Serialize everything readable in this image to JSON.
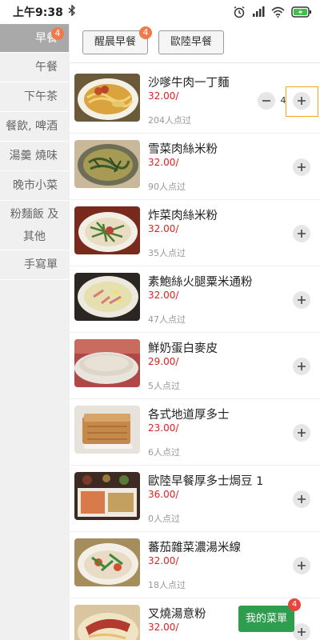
{
  "status_bar": {
    "time": "上午9:38"
  },
  "sidebar": {
    "categories": [
      {
        "label": "早餐",
        "badge": "4",
        "active": true
      },
      {
        "label": "午餐"
      },
      {
        "label": "下午茶"
      },
      {
        "label": "餐飲, 啤酒"
      },
      {
        "label": "湯羹 燒味"
      },
      {
        "label": "晚市小菜"
      },
      {
        "label_line1": "粉麵飯 及",
        "label_line2": "其他"
      },
      {
        "label": "手寫單"
      }
    ]
  },
  "subtabs": [
    {
      "label": "醒晨早餐",
      "badge": "4"
    },
    {
      "label": "歐陸早餐"
    }
  ],
  "items": [
    {
      "name": "沙嗲牛肉一丁麵",
      "price": "32.00/",
      "sold": "204人点过",
      "qty": "4"
    },
    {
      "name": "雪菜肉絲米粉",
      "price": "32.00/",
      "sold": "90人点过"
    },
    {
      "name": "炸菜肉絲米粉",
      "price": "32.00/",
      "sold": "35人点过"
    },
    {
      "name": "素鮑絲火腿粟米通粉",
      "price": "32.00/",
      "sold": "47人点过"
    },
    {
      "name": "鮮奶蛋白麥皮",
      "price": "29.00/",
      "sold": "5人点过"
    },
    {
      "name": "各式地道厚多士",
      "price": "23.00/",
      "sold": "6人点过"
    },
    {
      "name": "歐陸早餐厚多士焗豆 1",
      "price": "36.00/",
      "sold": "0人点过"
    },
    {
      "name": "蕃茄雜菜濃湯米線",
      "price": "32.00/",
      "sold": "18人点过"
    },
    {
      "name": "叉燒湯意粉",
      "price": "32.00/",
      "sold": ""
    }
  ],
  "cart": {
    "label": "我的菜單",
    "badge": "4"
  },
  "colors": {
    "price": "#e02020",
    "cart": "#2e9e4e",
    "badge": "#f07a4c",
    "active_category": "#a9a9a9"
  }
}
